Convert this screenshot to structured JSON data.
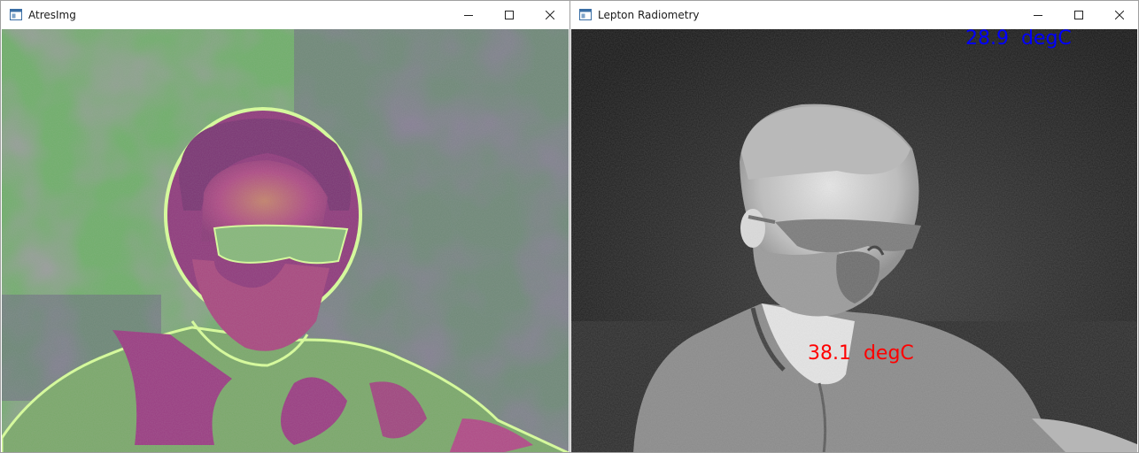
{
  "windows": [
    {
      "title": "AtresImg",
      "controls": {
        "minimize": "minimize-icon",
        "maximize": "maximize-icon",
        "close": "close-icon"
      }
    },
    {
      "title": "Lepton Radiometry",
      "controls": {
        "minimize": "minimize-icon",
        "maximize": "maximize-icon",
        "close": "close-icon"
      },
      "readouts": {
        "max_temp": "28.9  degC",
        "spot_temp": "38.1  degC"
      }
    }
  ],
  "colors": {
    "max_temp": "#0000ff",
    "spot_temp": "#ff0000",
    "title_bar": "#ffffff"
  },
  "icons": [
    "app-window-icon",
    "minimize-icon",
    "maximize-icon",
    "close-icon"
  ]
}
